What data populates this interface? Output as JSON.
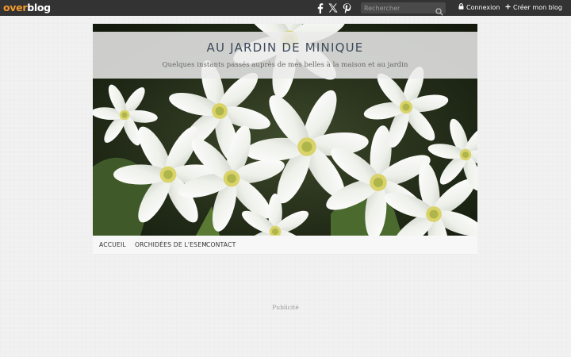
{
  "topbar": {
    "logo_over": "over",
    "logo_blog": "blog",
    "social": [
      "facebook-icon",
      "x-icon",
      "pinterest-icon"
    ],
    "search_placeholder": "Rechercher",
    "login_label": "Connexion",
    "create_blog_label": "Créer mon blog"
  },
  "header": {
    "title": "AU JARDIN DE MINIQUE",
    "subtitle": "Quelques instants passés auprès de mes belles à la maison et au jardin"
  },
  "nav": {
    "items": [
      "ACCUEIL",
      "ORCHIDÉES DE L'ESEM",
      "CONTACT"
    ]
  },
  "ad_label": "Publicité",
  "colors": {
    "topbar_bg": "#333333",
    "logo_accent": "#f29a2e",
    "title_color": "#3d4a5a",
    "page_bg": "#f1f1f1"
  }
}
